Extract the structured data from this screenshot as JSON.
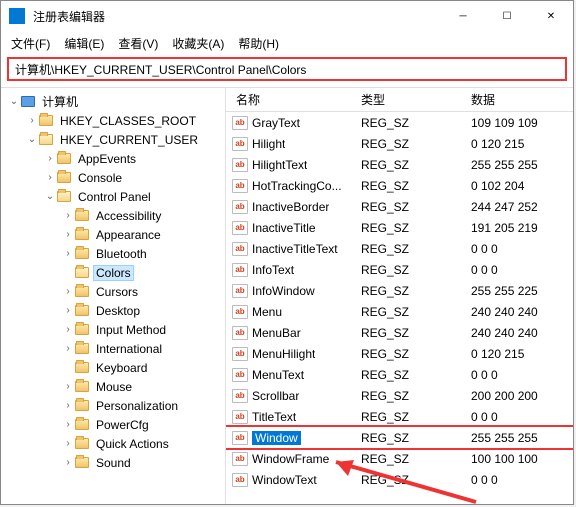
{
  "window": {
    "title": "注册表编辑器"
  },
  "menu": {
    "file": "文件(F)",
    "edit": "编辑(E)",
    "view": "查看(V)",
    "favorites": "收藏夹(A)",
    "help": "帮助(H)"
  },
  "address": "计算机\\HKEY_CURRENT_USER\\Control Panel\\Colors",
  "columns": {
    "name": "名称",
    "type": "类型",
    "data": "数据"
  },
  "tree": [
    {
      "indent": 0,
      "tw": "down",
      "icon": "pc",
      "label": "计算机"
    },
    {
      "indent": 1,
      "tw": "right",
      "icon": "folder",
      "label": "HKEY_CLASSES_ROOT"
    },
    {
      "indent": 1,
      "tw": "down",
      "icon": "folder-open",
      "label": "HKEY_CURRENT_USER"
    },
    {
      "indent": 2,
      "tw": "right",
      "icon": "folder",
      "label": "AppEvents"
    },
    {
      "indent": 2,
      "tw": "right",
      "icon": "folder",
      "label": "Console"
    },
    {
      "indent": 2,
      "tw": "down",
      "icon": "folder-open",
      "label": "Control Panel"
    },
    {
      "indent": 3,
      "tw": "right",
      "icon": "folder",
      "label": "Accessibility"
    },
    {
      "indent": 3,
      "tw": "right",
      "icon": "folder",
      "label": "Appearance"
    },
    {
      "indent": 3,
      "tw": "right",
      "icon": "folder",
      "label": "Bluetooth"
    },
    {
      "indent": 3,
      "tw": "none",
      "icon": "folder-open",
      "label": "Colors",
      "selected": true
    },
    {
      "indent": 3,
      "tw": "right",
      "icon": "folder",
      "label": "Cursors"
    },
    {
      "indent": 3,
      "tw": "right",
      "icon": "folder",
      "label": "Desktop"
    },
    {
      "indent": 3,
      "tw": "right",
      "icon": "folder",
      "label": "Input Method"
    },
    {
      "indent": 3,
      "tw": "right",
      "icon": "folder",
      "label": "International"
    },
    {
      "indent": 3,
      "tw": "none",
      "icon": "folder",
      "label": "Keyboard"
    },
    {
      "indent": 3,
      "tw": "right",
      "icon": "folder",
      "label": "Mouse"
    },
    {
      "indent": 3,
      "tw": "right",
      "icon": "folder",
      "label": "Personalization"
    },
    {
      "indent": 3,
      "tw": "right",
      "icon": "folder",
      "label": "PowerCfg"
    },
    {
      "indent": 3,
      "tw": "right",
      "icon": "folder",
      "label": "Quick Actions"
    },
    {
      "indent": 3,
      "tw": "right",
      "icon": "folder",
      "label": "Sound"
    }
  ],
  "values": [
    {
      "name": "GrayText",
      "type": "REG_SZ",
      "data": "109 109 109"
    },
    {
      "name": "Hilight",
      "type": "REG_SZ",
      "data": "0 120 215"
    },
    {
      "name": "HilightText",
      "type": "REG_SZ",
      "data": "255 255 255"
    },
    {
      "name": "HotTrackingCo...",
      "type": "REG_SZ",
      "data": "0 102 204"
    },
    {
      "name": "InactiveBorder",
      "type": "REG_SZ",
      "data": "244 247 252"
    },
    {
      "name": "InactiveTitle",
      "type": "REG_SZ",
      "data": "191 205 219"
    },
    {
      "name": "InactiveTitleText",
      "type": "REG_SZ",
      "data": "0 0 0"
    },
    {
      "name": "InfoText",
      "type": "REG_SZ",
      "data": "0 0 0"
    },
    {
      "name": "InfoWindow",
      "type": "REG_SZ",
      "data": "255 255 225"
    },
    {
      "name": "Menu",
      "type": "REG_SZ",
      "data": "240 240 240"
    },
    {
      "name": "MenuBar",
      "type": "REG_SZ",
      "data": "240 240 240"
    },
    {
      "name": "MenuHilight",
      "type": "REG_SZ",
      "data": "0 120 215"
    },
    {
      "name": "MenuText",
      "type": "REG_SZ",
      "data": "0 0 0"
    },
    {
      "name": "Scrollbar",
      "type": "REG_SZ",
      "data": "200 200 200"
    },
    {
      "name": "TitleText",
      "type": "REG_SZ",
      "data": "0 0 0"
    },
    {
      "name": "Window",
      "type": "REG_SZ",
      "data": "255 255 255",
      "selected": true
    },
    {
      "name": "WindowFrame",
      "type": "REG_SZ",
      "data": "100 100 100"
    },
    {
      "name": "WindowText",
      "type": "REG_SZ",
      "data": "0 0 0"
    }
  ]
}
